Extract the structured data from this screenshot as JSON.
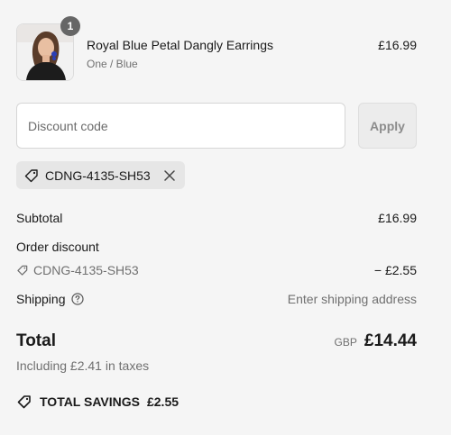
{
  "product": {
    "name": "Royal Blue Petal Dangly Earrings",
    "variant": "One / Blue",
    "price": "£16.99",
    "quantity": "1"
  },
  "discount": {
    "placeholder": "Discount code",
    "value": "",
    "apply_label": "Apply",
    "applied_code": "CDNG-4135-SH53"
  },
  "summary": {
    "subtotal_label": "Subtotal",
    "subtotal_value": "£16.99",
    "order_discount_label": "Order discount",
    "order_discount_code": "CDNG-4135-SH53",
    "order_discount_value": "− £2.55",
    "shipping_label": "Shipping",
    "shipping_value": "Enter shipping address",
    "total_label": "Total",
    "currency": "GBP",
    "total_value": "£14.44",
    "taxes_text": "Including £2.41 in taxes",
    "savings_label": "TOTAL SAVINGS",
    "savings_value": "£2.55"
  },
  "icons": {
    "tag": "tag-icon",
    "remove": "close-icon",
    "help": "help-circle-icon",
    "savings": "tag-icon"
  },
  "colors": {
    "background": "#f5f5f5",
    "text": "#1a1a1a",
    "muted": "#707070",
    "badge": "#666666"
  }
}
